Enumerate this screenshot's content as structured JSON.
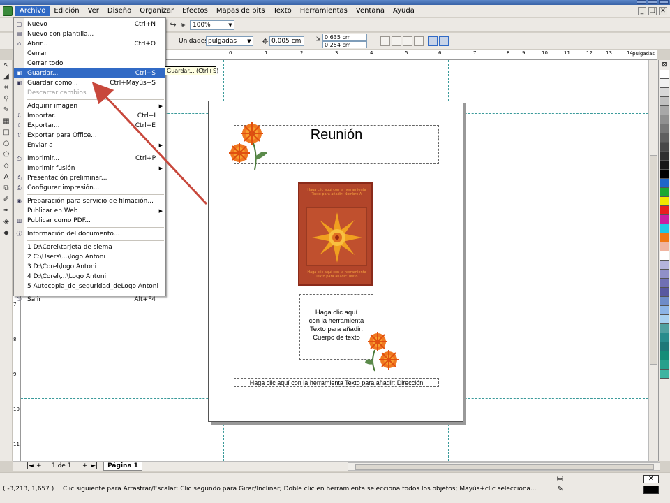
{
  "menubar": {
    "items": [
      {
        "label": "Archivo",
        "active": true
      },
      {
        "label": "Edición"
      },
      {
        "label": "Ver"
      },
      {
        "label": "Diseño"
      },
      {
        "label": "Organizar"
      },
      {
        "label": "Efectos"
      },
      {
        "label": "Mapas de bits"
      },
      {
        "label": "Texto"
      },
      {
        "label": "Herramientas"
      },
      {
        "label": "Ventana"
      },
      {
        "label": "Ayuda"
      }
    ]
  },
  "toolbar": {
    "zoom": "100%",
    "units_label": "Unidades:",
    "units_value": "pulgadas",
    "nudge": "0,005 cm",
    "dup_x": "0.635 cm",
    "dup_y": "0.254 cm"
  },
  "ruler": {
    "h_ticks": [
      "2",
      "1",
      "0",
      "1",
      "2",
      "3",
      "4",
      "5",
      "6",
      "7",
      "8",
      "9",
      "10",
      "11",
      "12",
      "13",
      "14"
    ],
    "h_units": "pulgadas",
    "v_ticks": [
      "7",
      "8",
      "9",
      "10",
      "11"
    ],
    "v_units": "pulgadas"
  },
  "file_menu": {
    "items": [
      {
        "label": "Nuevo",
        "shortcut": "Ctrl+N",
        "icon": "new-document-icon"
      },
      {
        "label": "Nuevo con plantilla...",
        "shortcut": "",
        "icon": "template-icon"
      },
      {
        "label": "Abrir...",
        "shortcut": "Ctrl+O",
        "icon": "open-folder-icon"
      },
      {
        "label": "Cerrar",
        "shortcut": "",
        "icon": ""
      },
      {
        "label": "Cerrar todo",
        "shortcut": "",
        "icon": ""
      },
      {
        "label": "Guardar...",
        "shortcut": "Ctrl+S",
        "icon": "save-icon",
        "highlighted": true
      },
      {
        "label": "Guardar como...",
        "shortcut": "Ctrl+Mayús+S",
        "icon": "save-as-icon"
      },
      {
        "label": "Descartar cambios",
        "shortcut": "",
        "icon": "",
        "disabled": true
      },
      {
        "label": "Adquirir imagen",
        "shortcut": "",
        "submenu": true
      },
      {
        "label": "Importar...",
        "shortcut": "Ctrl+I",
        "icon": "import-icon"
      },
      {
        "label": "Exportar...",
        "shortcut": "Ctrl+E",
        "icon": "export-icon"
      },
      {
        "label": "Exportar para Office...",
        "shortcut": "",
        "icon": "export-office-icon"
      },
      {
        "label": "Enviar a",
        "shortcut": "",
        "submenu": true
      },
      {
        "label": "Imprimir...",
        "shortcut": "Ctrl+P",
        "icon": "print-icon"
      },
      {
        "label": "Imprimir fusión",
        "shortcut": "",
        "submenu": true
      },
      {
        "label": "Presentación preliminar...",
        "shortcut": "",
        "icon": "print-preview-icon"
      },
      {
        "label": "Configurar impresión...",
        "shortcut": "",
        "icon": "print-setup-icon"
      },
      {
        "label": "Preparación para servicio de filmación...",
        "shortcut": "",
        "icon": "prepress-icon"
      },
      {
        "label": "Publicar en Web",
        "shortcut": "",
        "submenu": true
      },
      {
        "label": "Publicar como PDF...",
        "shortcut": "",
        "icon": "pdf-icon"
      },
      {
        "label": "Información del documento...",
        "shortcut": "",
        "icon": "info-icon"
      },
      {
        "label": "1 D:\\Corel\\tarjeta de siema",
        "shortcut": ""
      },
      {
        "label": "2 C:\\Users\\...\\logo Antoni",
        "shortcut": ""
      },
      {
        "label": "3 D:\\Corel\\logo Antoni",
        "shortcut": ""
      },
      {
        "label": "4 D:\\Corel\\...\\Logo Antoni",
        "shortcut": ""
      },
      {
        "label": "5 Autocopia_de_seguridad_deLogo Antoni",
        "shortcut": ""
      },
      {
        "label": "Salir",
        "shortcut": "Alt+F4",
        "icon": "exit-icon"
      }
    ]
  },
  "tooltip": "Guardar... (Ctrl+S)",
  "document": {
    "title": "Reunión",
    "body_text": [
      "Haga clic aquí",
      "con la herramienta",
      "Texto para añadir:",
      "Cuerpo de texto"
    ],
    "address_text": "Haga clic aquí con la herramienta Texto para añadir: Dirección",
    "poster_top": [
      "Haga clic aquí con la herramienta",
      "Texto para añadir: Nombre A"
    ],
    "poster_bottom": [
      "Haga clic aquí con la herramienta",
      "Texto para añadir: Texto"
    ]
  },
  "pagebar": {
    "counter": "1 de 1",
    "tab": "Página 1"
  },
  "status": {
    "coords": "( -3,213, 1,657 )",
    "message": "Clic siguiente para Arrastrar/Escalar; Clic segundo para Girar/Inclinar; Doble clic en herramienta selecciona todos los objetos; Mayús+clic selecciona..."
  },
  "palette": [
    "#ffffff",
    "#f0f0f0",
    "#d8d8d8",
    "#c0c0c0",
    "#a8a8a8",
    "#909090",
    "#787878",
    "#606060",
    "#484848",
    "#303030",
    "#181818",
    "#000000",
    "#1e66c8",
    "#1aa832",
    "#f0e600",
    "#e81e1e",
    "#c81ea0",
    "#1ec8e6",
    "#f07814",
    "#f0b4a0",
    "#ffffff",
    "#b4b4dc",
    "#9090c8",
    "#7070b4",
    "#5858a0",
    "#6e8cc8",
    "#8cb4e6",
    "#a8d0f0",
    "#50a0a0",
    "#288c8c",
    "#1e7878",
    "#148c78",
    "#28a08c",
    "#3cb4a0"
  ]
}
